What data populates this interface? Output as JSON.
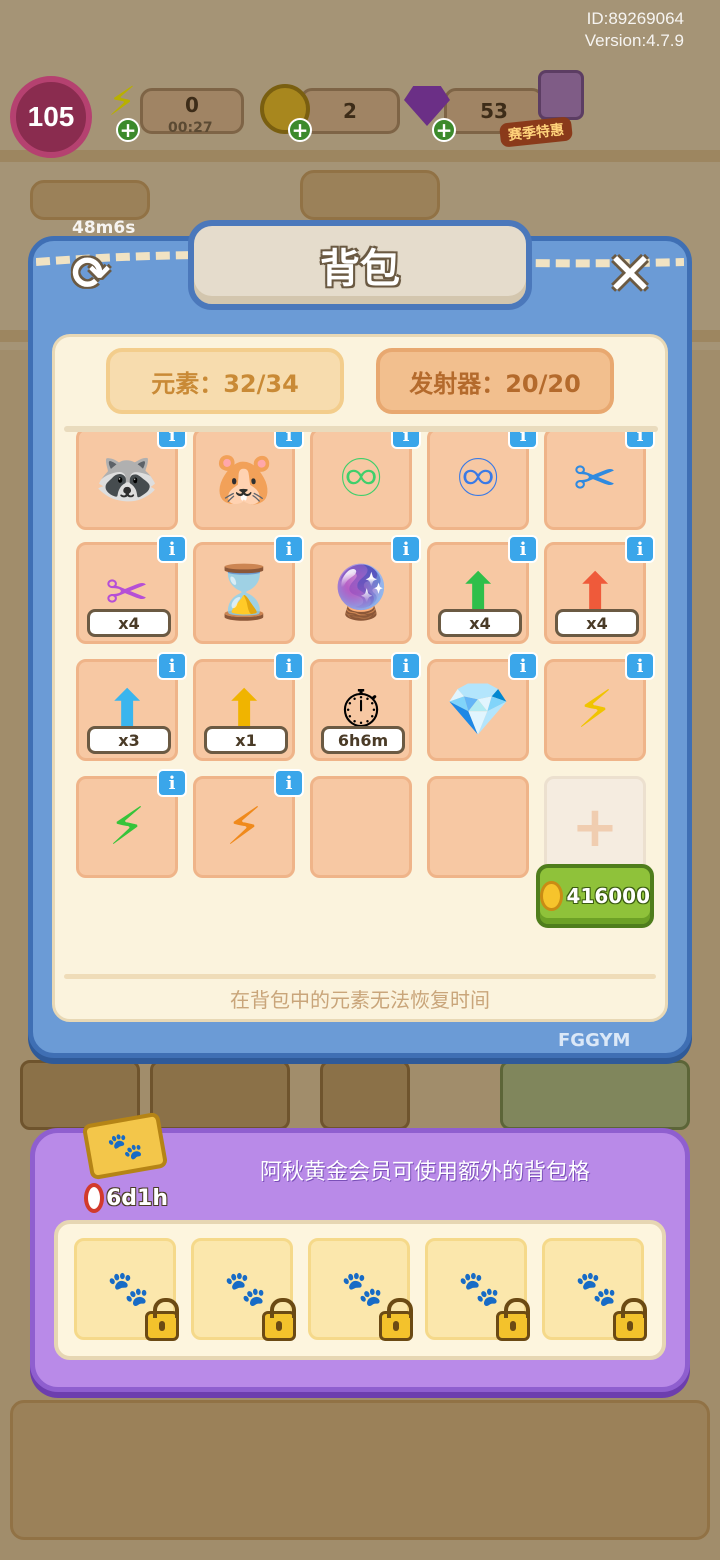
{
  "device": {
    "id_text": "ID:89269064",
    "version_text": "Version:4.7.9"
  },
  "top_bar": {
    "level": "105",
    "energy": {
      "value": "0",
      "timer": "00:27"
    },
    "coins": {
      "value": "2"
    },
    "gems": {
      "value": "53"
    },
    "season_label": "赛季特惠",
    "bg_timer": "48m6s"
  },
  "backpack": {
    "title": "背包",
    "elements_counter": "元素：32/34",
    "launchers_counter": "发射器：20/20",
    "price": "416000",
    "footer_note": "在背包中的元素无法恢复时间",
    "brand": "FGGYM",
    "info_symbol": "i",
    "plus_symbol": "+",
    "slots": [
      {
        "icon": "raccoon-hoodie-icon",
        "glyph": "🦝",
        "has_info": true
      },
      {
        "icon": "hamster-coin-icon",
        "glyph": "🐹",
        "has_info": true
      },
      {
        "icon": "green-infinity-hexagon-icon",
        "glyph": "♾",
        "color": "#3fcf6b",
        "has_info": true
      },
      {
        "icon": "blue-infinity-hexagon-icon",
        "glyph": "♾",
        "color": "#3a7ae6",
        "has_info": true
      },
      {
        "icon": "blue-scissors-icon",
        "glyph": "✂",
        "color": "#2f8ae0",
        "has_info": true
      },
      {
        "icon": "purple-scissors-icon",
        "glyph": "✂",
        "color": "#b64fd6",
        "has_info": true,
        "qty": "x4"
      },
      {
        "icon": "hourglass-hexagon-icon",
        "glyph": "⌛",
        "color": "#f0b400",
        "has_info": true
      },
      {
        "icon": "crystal-ball-launcher-icon",
        "glyph": "🔮",
        "has_info": true
      },
      {
        "icon": "green-arrow-card-icon",
        "glyph": "⬆",
        "color": "#2fbf4a",
        "has_info": true,
        "qty": "x4"
      },
      {
        "icon": "red-arrow-card-icon",
        "glyph": "⬆",
        "color": "#ef5a3a",
        "has_info": true,
        "qty": "x4"
      },
      {
        "icon": "blue-arrow-card-icon",
        "glyph": "⬆",
        "color": "#3ab5ee",
        "has_info": true,
        "qty": "x3"
      },
      {
        "icon": "yellow-arrow-card-icon",
        "glyph": "⬆",
        "color": "#f0b400",
        "has_info": true,
        "qty": "x1"
      },
      {
        "icon": "stopwatch-icon",
        "glyph": "⏱",
        "has_info": true,
        "qty": "6h6m"
      },
      {
        "icon": "pink-gem-icon",
        "glyph": "💎",
        "has_info": true
      },
      {
        "icon": "yellow-lightning-orb-icon",
        "glyph": "⚡",
        "color": "#f0c400",
        "has_info": true
      },
      {
        "icon": "green-lightning-orb-icon",
        "glyph": "⚡",
        "color": "#36c43a",
        "has_info": true
      },
      {
        "icon": "orange-lightning-orb-icon",
        "glyph": "⚡",
        "color": "#f08a1c",
        "has_info": true
      },
      {
        "icon": "empty-slot",
        "glyph": "",
        "has_info": false
      },
      {
        "icon": "empty-slot",
        "glyph": "",
        "has_info": false
      },
      {
        "icon": "add-slot-icon",
        "glyph": "",
        "has_info": false,
        "is_add": true
      }
    ]
  },
  "vip": {
    "timer": "6d1h",
    "message": "阿秋黄金会员可使用额外的背包格",
    "locked_slots": 5
  },
  "colors": {
    "panel_blue": "#6b9bd6",
    "slot_peach": "#f7c8a3",
    "vip_purple": "#b98ae8",
    "price_green": "#8fc23a"
  }
}
